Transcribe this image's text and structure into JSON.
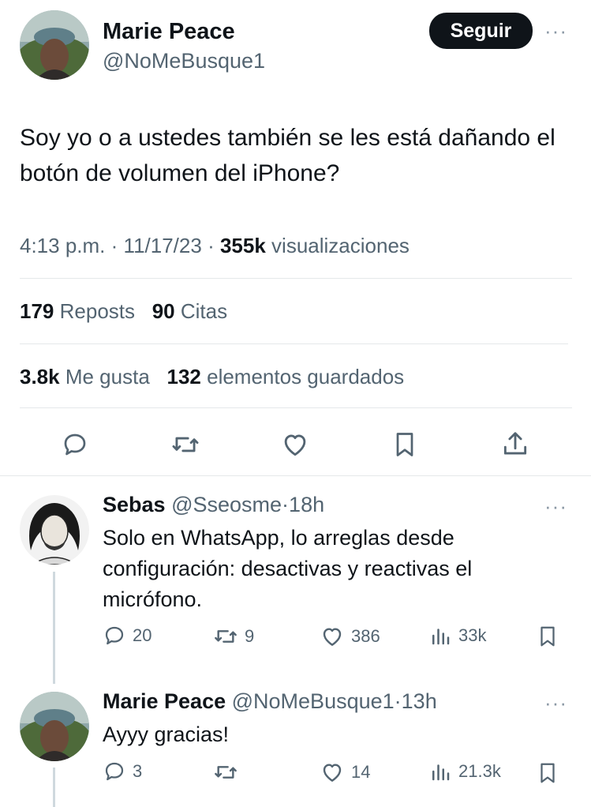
{
  "author": {
    "name": "Marie Peace",
    "handle": "@NoMeBusque1",
    "follow_label": "Seguir",
    "more_label": "···"
  },
  "tweet": {
    "text": "Soy yo o a ustedes también se les está dañando el botón de volumen del iPhone?",
    "time": "4:13 p.m.",
    "sep1": "·",
    "date": "11/17/23",
    "sep2": "·",
    "views_count": "355k",
    "views_label": "visualizaciones"
  },
  "stats": {
    "reposts_count": "179",
    "reposts_label": "Reposts",
    "quotes_count": "90",
    "quotes_label": "Citas",
    "likes_count": "3.8k",
    "likes_label": "Me gusta",
    "bookmarks_count": "132",
    "bookmarks_label": "elementos guardados"
  },
  "actions": [
    "reply-icon",
    "repost-icon",
    "like-icon",
    "bookmark-icon",
    "share-icon"
  ],
  "replies": [
    {
      "name": "Sebas",
      "handle": "@Sseosme",
      "sep": "·",
      "time": "18h",
      "text": "Solo en WhatsApp, lo arreglas desde configuración: desactivas y reactivas el micrófono.",
      "replies": "20",
      "reposts": "9",
      "likes": "386",
      "views": "33k"
    },
    {
      "name": "Marie Peace",
      "handle": "@NoMeBusque1",
      "sep": "·",
      "time": "13h",
      "text": "Ayyy gracias!",
      "replies": "3",
      "reposts": "",
      "likes": "14",
      "views": "21.3k"
    }
  ],
  "colors": {
    "text": "#0f1419",
    "secondary": "#536471",
    "divider": "#e5e8ea",
    "button_bg": "#0f1419"
  }
}
